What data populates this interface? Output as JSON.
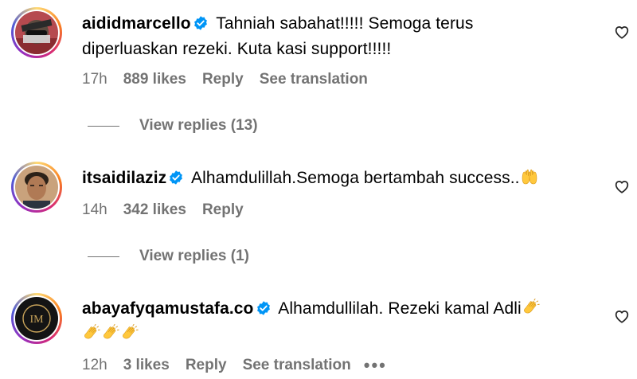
{
  "comments": [
    {
      "username": "aididmarcello",
      "text_line1": "Tahniah sabahat!!!!! Semoga terus",
      "text_line2": "diperluaskan rezeki. Kuta kasi support!!!!!",
      "time": "17h",
      "likes": "889 likes",
      "reply": "Reply",
      "translate": "See translation",
      "view_replies": "View replies (13)"
    },
    {
      "username": "itsaidilaziz",
      "text": "Alhamdulillah.Semoga bertambah success..",
      "time": "14h",
      "likes": "342 likes",
      "reply": "Reply",
      "view_replies": "View replies (1)"
    },
    {
      "username": "abayafyqamustafa.co",
      "text": "Alhamdullilah. Rezeki kamal Adli",
      "time": "12h",
      "likes": "3 likes",
      "reply": "Reply",
      "translate": "See translation",
      "more": "•••"
    }
  ],
  "colors": {
    "text": "#000000",
    "meta": "#737373",
    "verified": "#0095f6",
    "emoji": "#ffc83d"
  },
  "icons": {
    "verified": "verified-badge-icon",
    "like": "heart-outline-icon",
    "hands": "raised-hands-emoji",
    "clap": "clapping-hands-emoji"
  },
  "avatar_monogram": "IM"
}
